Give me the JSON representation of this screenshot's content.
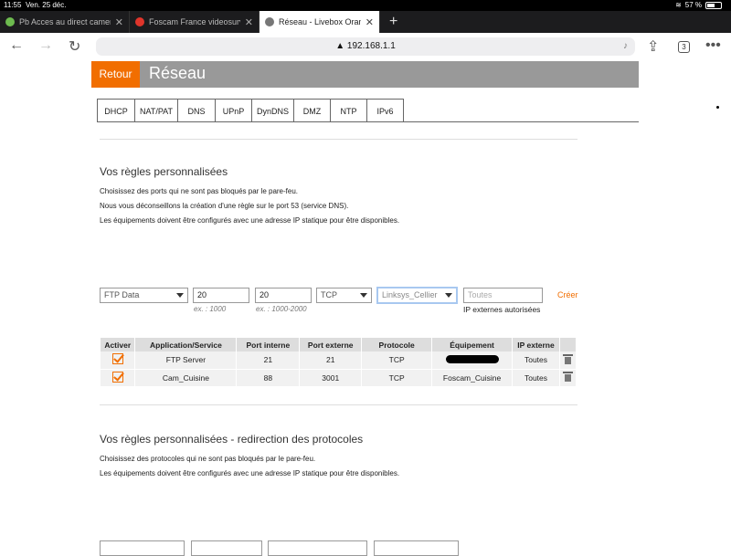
{
  "status": {
    "time": "11:55",
    "date": "Ven. 25 déc.",
    "battery": "57 %",
    "battery_level": 0.57
  },
  "browser": {
    "tabs": [
      {
        "label": "Pb Acces au direct camera",
        "favicon_color": "#6dbb4f"
      },
      {
        "label": "Foscam France videosurveillance",
        "favicon_color": "#e0352b"
      },
      {
        "label": "Réseau - Livebox Orange",
        "favicon_color": "#777777"
      }
    ],
    "url": "192.168.1.1",
    "tab_count": "3",
    "icons": [
      "back-icon",
      "forward-icon",
      "reload-icon",
      "lock-icon",
      "mic-icon",
      "share-icon",
      "tabs-icon",
      "more-icon"
    ]
  },
  "header": {
    "back": "Retour",
    "title": "Réseau"
  },
  "nav_tabs": [
    "DHCP",
    "NAT/PAT",
    "DNS",
    "UPnP",
    "DynDNS",
    "DMZ",
    "NTP",
    "IPv6"
  ],
  "section1": {
    "title": "Vos règles personnalisées",
    "lines": [
      "Choisissez des ports qui ne sont pas bloqués par le pare-feu.",
      "Nous vous déconseillons la création d'une règle sur le port 53 (service DNS).",
      "Les équipements doivent être configurés avec une adresse IP statique pour être disponibles."
    ],
    "form": {
      "application": "FTP Data",
      "internal_port": "20",
      "internal_hint": "ex. : 1000",
      "external_port": "20",
      "external_hint": "ex. : 1000-2000",
      "protocol": "TCP",
      "device": "Linksys_Cellier",
      "external_ip_placeholder": "Toutes",
      "external_ip_hint": "IP externes autorisées",
      "create": "Créer"
    },
    "table": {
      "headers": [
        "Activer",
        "Application/Service",
        "Port interne",
        "Port externe",
        "Protocole",
        "Équipement",
        "IP externe"
      ],
      "rows": [
        {
          "app": "FTP Server",
          "internal": "21",
          "external": "21",
          "protocol": "TCP",
          "device": "",
          "ip": "Toutes"
        },
        {
          "app": "Cam_Cuisine",
          "internal": "88",
          "external": "3001",
          "protocol": "TCP",
          "device": "Foscam_Cuisine",
          "ip": "Toutes"
        }
      ]
    }
  },
  "section2": {
    "title": "Vos règles personnalisées - redirection des protocoles",
    "lines": [
      "Choisissez des protocoles qui ne sont pas bloqués par le pare-feu.",
      "Les équipements doivent être configurés avec une adresse IP statique pour être disponibles."
    ]
  }
}
